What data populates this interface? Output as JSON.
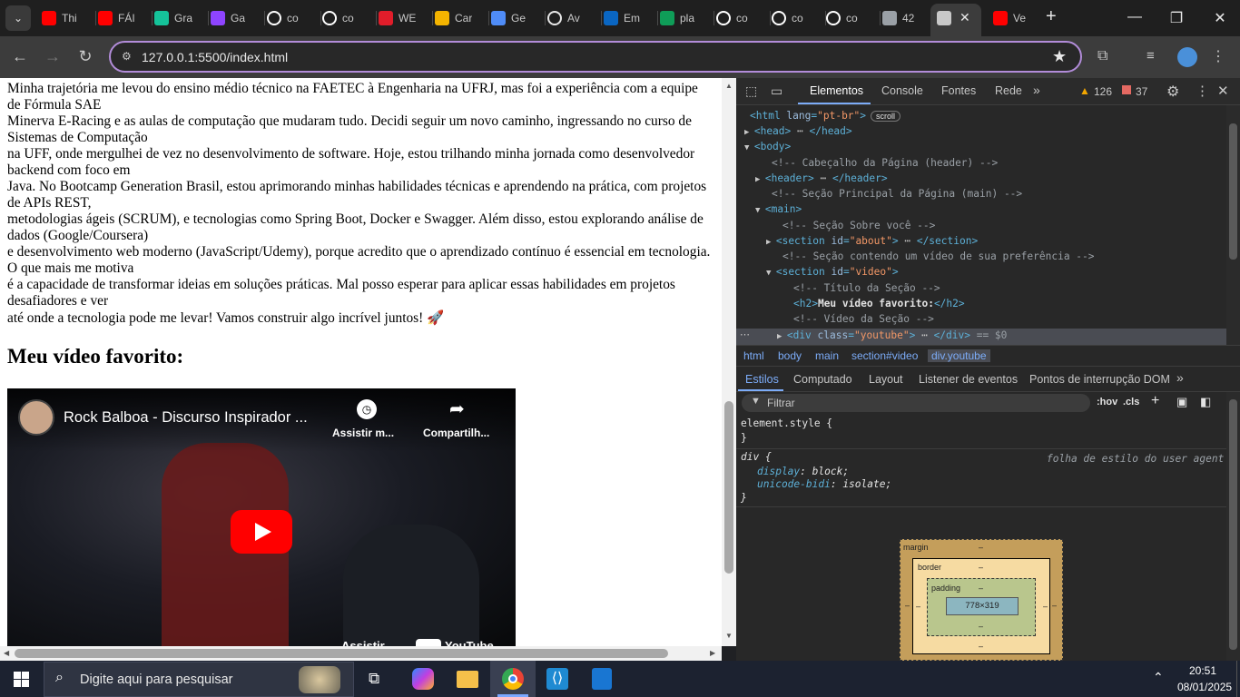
{
  "browser": {
    "tabs": [
      {
        "label": "Thi",
        "icon": "youtube-icon",
        "color": "#ff0000"
      },
      {
        "label": "FÁI",
        "icon": "youtube-icon",
        "color": "#ff0000"
      },
      {
        "label": "Gra",
        "icon": "grammarly-icon",
        "color": "#15c39a"
      },
      {
        "label": "Ga",
        "icon": "purple-app-icon",
        "color": "#8e44ff"
      },
      {
        "label": "co",
        "icon": "github-icon",
        "color": "#ffffff"
      },
      {
        "label": "co",
        "icon": "github-icon",
        "color": "#ffffff"
      },
      {
        "label": "WE",
        "icon": "wec-icon",
        "color": "#e11d2a"
      },
      {
        "label": "Car",
        "icon": "canva-icon",
        "color": "#f4b400"
      },
      {
        "label": "Ge",
        "icon": "gemini-icon",
        "color": "#4f8cf7"
      },
      {
        "label": "Av",
        "icon": "openai-icon",
        "color": "#e8e8e8"
      },
      {
        "label": "Em",
        "icon": "outlook-icon",
        "color": "#0a66c2"
      },
      {
        "label": "pla",
        "icon": "sheets-icon",
        "color": "#0f9d58"
      },
      {
        "label": "co",
        "icon": "github-icon",
        "color": "#ffffff"
      },
      {
        "label": "co",
        "icon": "github-icon",
        "color": "#ffffff"
      },
      {
        "label": "co",
        "icon": "github-icon",
        "color": "#ffffff"
      },
      {
        "label": "42",
        "icon": "dots-icon",
        "color": "#9aa0a6"
      },
      {
        "label": "",
        "icon": "globe-icon",
        "color": "#c8c8c8"
      },
      {
        "label": "Ve",
        "icon": "youtube-icon",
        "color": "#ff0000"
      }
    ],
    "url": "127.0.0.1:5500/index.html"
  },
  "page": {
    "paragraph_lines": [
      "Minha trajetória me levou do ensino médio técnico na FAETEC à Engenharia na UFRJ, mas foi a experiência com a equipe de Fórmula SAE",
      "Minerva E-Racing e as aulas de computação que mudaram tudo. Decidi seguir um novo caminho, ingressando no curso de Sistemas de Computação",
      "na UFF, onde mergulhei de vez no desenvolvimento de software. Hoje, estou trilhando minha jornada como desenvolvedor backend com foco em",
      "Java. No Bootcamp Generation Brasil, estou aprimorando minhas habilidades técnicas e aprendendo na prática, com projetos de APIs REST,",
      "metodologias ágeis (SCRUM), e tecnologias como Spring Boot, Docker e Swagger. Além disso, estou explorando análise de dados (Google/Coursera)",
      "e desenvolvimento web moderno (JavaScript/Udemy), porque acredito que o aprendizado contínuo é essencial em tecnologia. O que mais me motiva",
      "é a capacidade de transformar ideias em soluções práticas. Mal posso esperar para aplicar essas habilidades em projetos desafiadores e ver",
      "até onde a tecnologia pode me levar! Vamos construir algo incrível juntos! 🚀"
    ],
    "video_heading": "Meu vídeo favorito:",
    "video": {
      "title": "Rock Balboa - Discurso Inspirador ...",
      "watch_later": "Assistir m...",
      "share": "Compartilh...",
      "footer_watch": "Assistir",
      "footer_youtube": "YouTube"
    }
  },
  "devtools": {
    "tabs": [
      "Elementos",
      "Console",
      "Fontes",
      "Rede"
    ],
    "warnings": "126",
    "errors": "37",
    "tree": [
      {
        "parts": [
          [
            "tag",
            "<html "
          ],
          [
            "attr",
            "lang"
          ],
          [
            "tag",
            "="
          ],
          [
            "val",
            "\"pt-br\""
          ],
          [
            "tag",
            ">"
          ]
        ],
        "badge": "scroll"
      },
      {
        "parts": [
          [
            "tag",
            "<head>"
          ],
          [
            "tri",
            " ⋯ "
          ],
          [
            "tag",
            "</head>"
          ]
        ]
      },
      {
        "parts": [
          [
            "tag",
            "<body>"
          ]
        ]
      },
      {
        "parts": [
          [
            "cmt",
            "<!-- Cabeçalho da Página (header) -->"
          ]
        ]
      },
      {
        "parts": [
          [
            "tag",
            "<header>"
          ],
          [
            "tri",
            " ⋯ "
          ],
          [
            "tag",
            "</header>"
          ]
        ]
      },
      {
        "parts": [
          [
            "cmt",
            "<!-- Seção Principal da Página (main) -->"
          ]
        ]
      },
      {
        "parts": [
          [
            "tag",
            "<main>"
          ]
        ]
      },
      {
        "parts": [
          [
            "cmt",
            "<!-- Seção Sobre você -->"
          ]
        ]
      },
      {
        "parts": [
          [
            "tag",
            "<section "
          ],
          [
            "attr",
            "id"
          ],
          [
            "tag",
            "="
          ],
          [
            "val",
            "\"about\""
          ],
          [
            "tag",
            ">"
          ],
          [
            "tri",
            " ⋯ "
          ],
          [
            "tag",
            "</section>"
          ]
        ]
      },
      {
        "parts": [
          [
            "cmt",
            "<!-- Seção contendo um vídeo de sua preferência -->"
          ]
        ]
      },
      {
        "parts": [
          [
            "tag",
            "<section "
          ],
          [
            "attr",
            "id"
          ],
          [
            "tag",
            "="
          ],
          [
            "val",
            "\"video\""
          ],
          [
            "tag",
            ">"
          ]
        ]
      },
      {
        "parts": [
          [
            "cmt",
            "<!-- Título da Seção -->"
          ]
        ]
      },
      {
        "parts": [
          [
            "tag",
            "<h2>"
          ],
          [
            "text",
            "Meu vídeo favorito:"
          ],
          [
            "tag",
            "</h2>"
          ]
        ]
      },
      {
        "parts": [
          [
            "cmt",
            "<!-- Vídeo da Seção -->"
          ]
        ]
      },
      {
        "parts": [
          [
            "tag",
            "<div "
          ],
          [
            "attr",
            "class"
          ],
          [
            "tag",
            "="
          ],
          [
            "val",
            "\"youtube\""
          ],
          [
            "tag",
            ">"
          ],
          [
            "tri",
            " ⋯ "
          ],
          [
            "tag",
            "</div>"
          ],
          [
            "cmt",
            " == $0"
          ]
        ]
      }
    ],
    "breadcrumbs": [
      "html",
      "body",
      "main",
      "section#video",
      "div.youtube"
    ],
    "style_tabs": [
      "Estilos",
      "Computado",
      "Layout",
      "Listener de eventos",
      "Pontos de interrupção DOM"
    ],
    "filter_placeholder": "Filtrar",
    "hov": ":hov",
    "cls": ".cls",
    "element_style": "element.style {",
    "close_brace": "}",
    "rule_selector": "div {",
    "rule_source": "folha de estilo do user agent",
    "decl1_prop": "display",
    "decl1_val": "block;",
    "decl2_prop": "unicode-bidi",
    "decl2_val": "isolate;",
    "box": {
      "margin": "margin",
      "border": "border",
      "padding": "padding",
      "dash": "–",
      "content": "778×319"
    }
  },
  "taskbar": {
    "search_placeholder": "Digite aqui para pesquisar",
    "time": "20:51",
    "date": "08/01/2025"
  }
}
